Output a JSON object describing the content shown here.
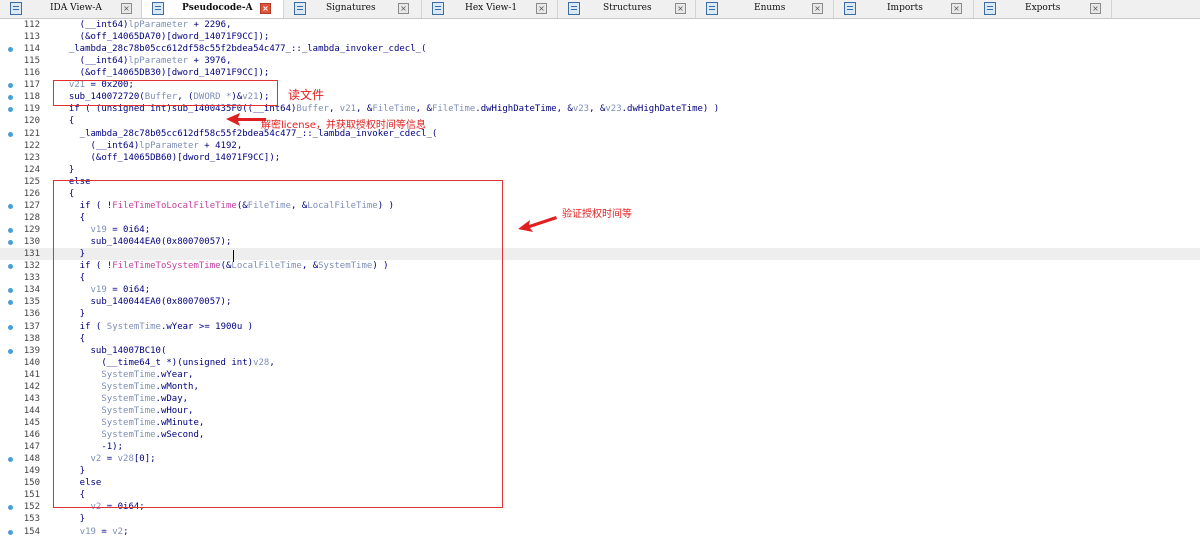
{
  "tabs": [
    {
      "label": "IDA View-A",
      "active": false
    },
    {
      "label": "Pseudocode-A",
      "active": true
    },
    {
      "label": "Signatures",
      "active": false
    },
    {
      "label": "Hex View-1",
      "active": false
    },
    {
      "label": "Structures",
      "active": false
    },
    {
      "label": "Enums",
      "active": false
    },
    {
      "label": "Imports",
      "active": false
    },
    {
      "label": "Exports",
      "active": false
    }
  ],
  "close_glyph": "×",
  "lines": [
    {
      "n": "112",
      "bp": false,
      "parts": [
        [
          "    (",
          ""
        ],
        [
          "__int64",
          ""
        ],
        [
          ")",
          ""
        ],
        [
          "lpParameter",
          "v"
        ],
        [
          " + 2296,",
          ""
        ]
      ]
    },
    {
      "n": "113",
      "bp": false,
      "parts": [
        [
          "    (&off_14065DA70)[dword_14071F9CC]);",
          ""
        ]
      ]
    },
    {
      "n": "114",
      "bp": true,
      "parts": [
        [
          "  _lambda_28c78b05cc612df58c55f2bdea54c477_::_lambda_invoker_cdecl_(",
          ""
        ]
      ]
    },
    {
      "n": "115",
      "bp": false,
      "parts": [
        [
          "    (__int64)",
          ""
        ],
        [
          "lpParameter",
          "v"
        ],
        [
          " + 3976,",
          ""
        ]
      ]
    },
    {
      "n": "116",
      "bp": false,
      "parts": [
        [
          "    (&off_14065DB30)[dword_14071F9CC]);",
          ""
        ]
      ]
    },
    {
      "n": "117",
      "bp": true,
      "parts": [
        [
          "  ",
          ""
        ],
        [
          "v21",
          "v"
        ],
        [
          " = 0x200;",
          ""
        ]
      ]
    },
    {
      "n": "118",
      "bp": true,
      "parts": [
        [
          "  sub_140072720(",
          ""
        ],
        [
          "Buffer",
          "v"
        ],
        [
          ", (",
          ""
        ],
        [
          "DWORD *",
          "v"
        ],
        [
          ")&",
          ""
        ],
        [
          "v21",
          "v"
        ],
        [
          ");",
          ""
        ]
      ]
    },
    {
      "n": "119",
      "bp": true,
      "parts": [
        [
          "  if ( (unsigned int)sub_1400435F0((__int64)",
          ""
        ],
        [
          "Buffer",
          "v"
        ],
        [
          ", ",
          ""
        ],
        [
          "v21",
          "v"
        ],
        [
          ", &",
          ""
        ],
        [
          "FileTime",
          "v"
        ],
        [
          ", &",
          ""
        ],
        [
          "FileTime",
          "v"
        ],
        [
          ".dwHighDateTime, &",
          ""
        ],
        [
          "v23",
          "v"
        ],
        [
          ", &",
          ""
        ],
        [
          "v23",
          "v"
        ],
        [
          ".dwHighDateTime) )",
          ""
        ]
      ]
    },
    {
      "n": "120",
      "bp": false,
      "parts": [
        [
          "  {",
          ""
        ]
      ]
    },
    {
      "n": "121",
      "bp": true,
      "parts": [
        [
          "    _lambda_28c78b05cc612df58c55f2bdea54c477_::_lambda_invoker_cdecl_(",
          ""
        ]
      ]
    },
    {
      "n": "122",
      "bp": false,
      "parts": [
        [
          "      (__int64)",
          ""
        ],
        [
          "lpParameter",
          "v"
        ],
        [
          " + 4192,",
          ""
        ]
      ]
    },
    {
      "n": "123",
      "bp": false,
      "parts": [
        [
          "      (&off_14065DB60)[dword_14071F9CC]);",
          ""
        ]
      ]
    },
    {
      "n": "124",
      "bp": false,
      "parts": [
        [
          "  }",
          ""
        ]
      ]
    },
    {
      "n": "125",
      "bp": false,
      "parts": [
        [
          "  else",
          ""
        ]
      ]
    },
    {
      "n": "126",
      "bp": false,
      "parts": [
        [
          "  {",
          ""
        ]
      ]
    },
    {
      "n": "127",
      "bp": true,
      "parts": [
        [
          "    if ( !",
          ""
        ],
        [
          "FileTimeToLocalFileTime",
          "f"
        ],
        [
          "(&",
          ""
        ],
        [
          "FileTime",
          "v"
        ],
        [
          ", &",
          ""
        ],
        [
          "LocalFileTime",
          "v"
        ],
        [
          ") )",
          ""
        ]
      ]
    },
    {
      "n": "128",
      "bp": false,
      "parts": [
        [
          "    {",
          ""
        ]
      ]
    },
    {
      "n": "129",
      "bp": true,
      "parts": [
        [
          "      ",
          ""
        ],
        [
          "v19",
          "v"
        ],
        [
          " = 0i64;",
          ""
        ]
      ]
    },
    {
      "n": "130",
      "bp": true,
      "parts": [
        [
          "      sub_140044EA0(0x80070057);",
          ""
        ]
      ]
    },
    {
      "n": "131",
      "bp": false,
      "hl": true,
      "parts": [
        [
          "    }",
          ""
        ]
      ]
    },
    {
      "n": "132",
      "bp": true,
      "parts": [
        [
          "    if ( !",
          ""
        ],
        [
          "FileTimeToSystemTime",
          "f"
        ],
        [
          "(&",
          ""
        ],
        [
          "LocalFileTime",
          "v"
        ],
        [
          ", &",
          ""
        ],
        [
          "SystemTime",
          "v"
        ],
        [
          ") )",
          ""
        ]
      ]
    },
    {
      "n": "133",
      "bp": false,
      "parts": [
        [
          "    {",
          ""
        ]
      ]
    },
    {
      "n": "134",
      "bp": true,
      "parts": [
        [
          "      ",
          ""
        ],
        [
          "v19",
          "v"
        ],
        [
          " = 0i64;",
          ""
        ]
      ]
    },
    {
      "n": "135",
      "bp": true,
      "parts": [
        [
          "      sub_140044EA0(0x80070057);",
          ""
        ]
      ]
    },
    {
      "n": "136",
      "bp": false,
      "parts": [
        [
          "    }",
          ""
        ]
      ]
    },
    {
      "n": "137",
      "bp": true,
      "parts": [
        [
          "    if ( ",
          ""
        ],
        [
          "SystemTime",
          "v"
        ],
        [
          ".wYear >= 1900u )",
          ""
        ]
      ]
    },
    {
      "n": "138",
      "bp": false,
      "parts": [
        [
          "    {",
          ""
        ]
      ]
    },
    {
      "n": "139",
      "bp": true,
      "parts": [
        [
          "      sub_14007BC10(",
          ""
        ]
      ]
    },
    {
      "n": "140",
      "bp": false,
      "parts": [
        [
          "        (__time64_t *)(unsigned int)",
          ""
        ],
        [
          "v28",
          "v"
        ],
        [
          ",",
          ""
        ]
      ]
    },
    {
      "n": "141",
      "bp": false,
      "parts": [
        [
          "        ",
          ""
        ],
        [
          "SystemTime",
          "v"
        ],
        [
          ".wYear,",
          ""
        ]
      ]
    },
    {
      "n": "142",
      "bp": false,
      "parts": [
        [
          "        ",
          ""
        ],
        [
          "SystemTime",
          "v"
        ],
        [
          ".wMonth,",
          ""
        ]
      ]
    },
    {
      "n": "143",
      "bp": false,
      "parts": [
        [
          "        ",
          ""
        ],
        [
          "SystemTime",
          "v"
        ],
        [
          ".wDay,",
          ""
        ]
      ]
    },
    {
      "n": "144",
      "bp": false,
      "parts": [
        [
          "        ",
          ""
        ],
        [
          "SystemTime",
          "v"
        ],
        [
          ".wHour,",
          ""
        ]
      ]
    },
    {
      "n": "145",
      "bp": false,
      "parts": [
        [
          "        ",
          ""
        ],
        [
          "SystemTime",
          "v"
        ],
        [
          ".wMinute,",
          ""
        ]
      ]
    },
    {
      "n": "146",
      "bp": false,
      "parts": [
        [
          "        ",
          ""
        ],
        [
          "SystemTime",
          "v"
        ],
        [
          ".wSecond,",
          ""
        ]
      ]
    },
    {
      "n": "147",
      "bp": false,
      "parts": [
        [
          "        -1);",
          ""
        ]
      ]
    },
    {
      "n": "148",
      "bp": true,
      "parts": [
        [
          "      ",
          ""
        ],
        [
          "v2",
          "v"
        ],
        [
          " = ",
          ""
        ],
        [
          "v28",
          "v"
        ],
        [
          "[0];",
          ""
        ]
      ]
    },
    {
      "n": "149",
      "bp": false,
      "parts": [
        [
          "    }",
          ""
        ]
      ]
    },
    {
      "n": "150",
      "bp": false,
      "parts": [
        [
          "    else",
          ""
        ]
      ]
    },
    {
      "n": "151",
      "bp": false,
      "parts": [
        [
          "    {",
          ""
        ]
      ]
    },
    {
      "n": "152",
      "bp": true,
      "parts": [
        [
          "      ",
          ""
        ],
        [
          "v2",
          "v"
        ],
        [
          " = 0i64;",
          ""
        ]
      ]
    },
    {
      "n": "153",
      "bp": false,
      "parts": [
        [
          "    }",
          ""
        ]
      ]
    },
    {
      "n": "154",
      "bp": true,
      "parts": [
        [
          "    ",
          ""
        ],
        [
          "v19",
          "v"
        ],
        [
          " = ",
          ""
        ],
        [
          "v2",
          "v"
        ],
        [
          ";",
          ""
        ]
      ]
    }
  ],
  "annotations": {
    "read_file": "读文件",
    "decrypt_license": "解密license，并获取授权时间等信息",
    "verify_time": "验证授权时间等"
  },
  "colors": {
    "keyword": "#00007f",
    "variable": "#7d8fb6",
    "function": "#c33ea0",
    "breakpoint_dot": "#4a9fd8",
    "annotation_red": "#e02020",
    "current_line": "#eeeeee"
  }
}
